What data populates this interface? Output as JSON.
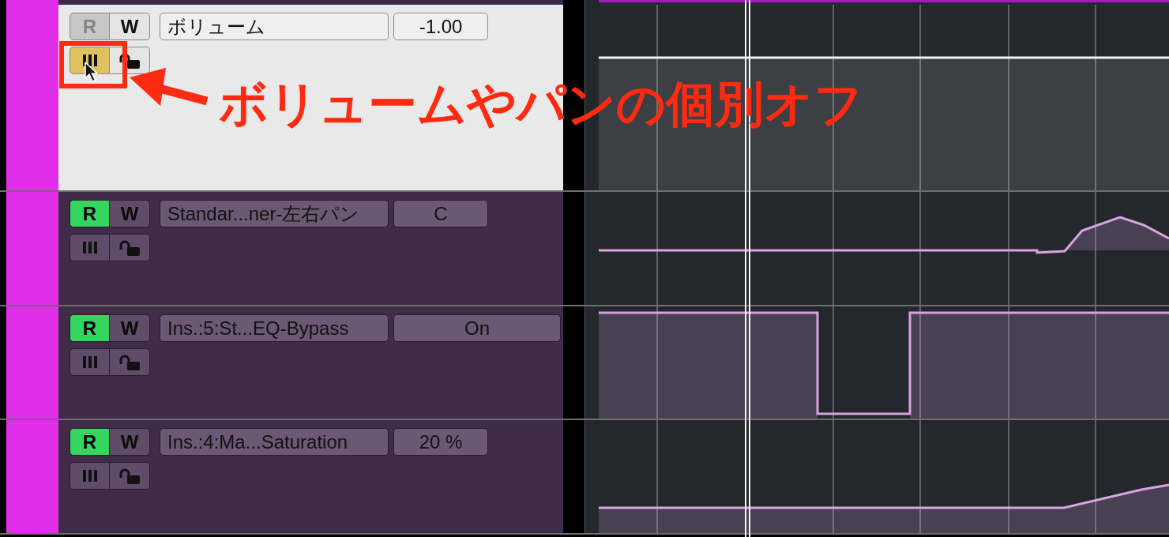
{
  "tracks": [
    {
      "selected": true,
      "read_label": "R",
      "read": false,
      "write_label": "W",
      "write": false,
      "automation_off": true,
      "locked": false,
      "parameter": "ボリューム",
      "value": "-1.00",
      "kind": "continuous"
    },
    {
      "selected": false,
      "read_label": "R",
      "read": true,
      "write_label": "W",
      "write": false,
      "automation_off": false,
      "locked": false,
      "parameter": "Standar...ner-左右パン",
      "value": "C",
      "kind": "continuous"
    },
    {
      "selected": false,
      "read_label": "R",
      "read": true,
      "write_label": "W",
      "write": false,
      "automation_off": false,
      "locked": false,
      "parameter": "Ins.:5:St...EQ-Bypass",
      "value": "On",
      "kind": "switch"
    },
    {
      "selected": false,
      "read_label": "R",
      "read": true,
      "write_label": "W",
      "write": false,
      "automation_off": false,
      "locked": false,
      "parameter": "Ins.:4:Ma...Saturation",
      "value": "20 %",
      "kind": "continuous"
    }
  ],
  "annotation": {
    "text": "ボリュームやパンの個別オフ"
  }
}
